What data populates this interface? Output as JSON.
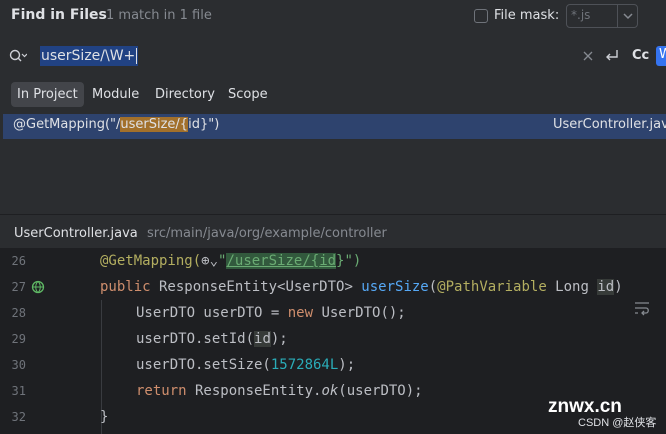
{
  "header": {
    "title": "Find in Files",
    "match_count": "1 match in 1 file",
    "file_mask_label": "File mask:",
    "file_mask_value": "*.js"
  },
  "search": {
    "query": "userSize/\\W+",
    "case_toggle": "Cc",
    "regex_toggle": "W"
  },
  "scopes": [
    {
      "label": "In Project",
      "active": true
    },
    {
      "label": "Module",
      "active": false
    },
    {
      "label": "Directory",
      "active": false
    },
    {
      "label": "Scope",
      "active": false
    }
  ],
  "result": {
    "prefix": "@GetMapping(\"/",
    "match": "userSize/{",
    "suffix": "id}\")",
    "file": "UserController.java"
  },
  "preview": {
    "file_name": "UserController.java",
    "path": "src/main/java/org/example/controller"
  },
  "code": {
    "lines": [
      {
        "num": "26"
      },
      {
        "num": "27"
      },
      {
        "num": "28"
      },
      {
        "num": "29"
      },
      {
        "num": "30"
      },
      {
        "num": "31"
      },
      {
        "num": "32"
      }
    ],
    "l26": {
      "ann": "@GetMapping(",
      "q": "\"",
      "path": "/userSize/{",
      "id": "id",
      "close": "}\")"
    },
    "l27": {
      "kw": "public",
      "type": " ResponseEntity<UserDTO> ",
      "fn": "userSize",
      "open": "(",
      "ann": "@PathVariable",
      "rest": " Long ",
      "id": "id",
      "close": ")"
    },
    "l28": {
      "pre": "UserDTO userDTO = ",
      "kw": "new",
      "post": " UserDTO();"
    },
    "l29": {
      "pre": "userDTO.setId(",
      "id": "id",
      "post": ");"
    },
    "l30": {
      "pre": "userDTO.setSize(",
      "num": "1572864L",
      "post": ");"
    },
    "l31": {
      "kw": "return",
      "pre": " ResponseEntity.",
      "it": "ok",
      "post": "(userDTO);"
    },
    "l32": {
      "text": "}"
    }
  },
  "watermark": {
    "brand": "znwx.cn",
    "credit": "CSDN @赵侠客"
  },
  "colors": {
    "background": "#2b2d30",
    "editor": "#1e1f22",
    "selection": "#2e436e",
    "match_highlight": "#a2702b",
    "accent": "#3574f0"
  },
  "icons": {
    "search": "search-history-icon",
    "clear": "clear-icon",
    "newline": "newline-icon",
    "run": "run-gutter-icon",
    "wrap": "soft-wrap-icon",
    "chevron": "chevron-down-icon"
  }
}
